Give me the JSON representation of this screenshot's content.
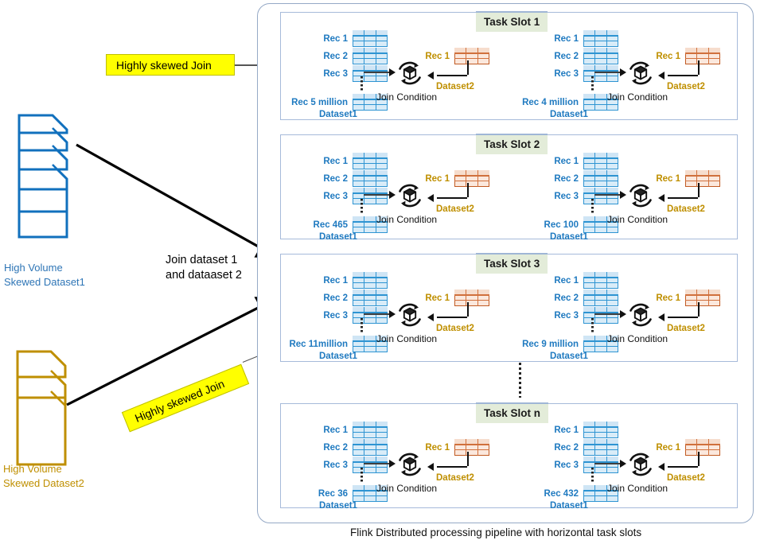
{
  "diagram": {
    "bottom_caption": "Flink Distributed processing pipeline with horizontal task slots",
    "center_note_line1": "Join dataset 1",
    "center_note_line2": "and dataaset 2"
  },
  "sources": [
    {
      "id": "dataset1",
      "caption_line1": "High Volume",
      "caption_line2": "Skewed Dataset1",
      "color": "#1170bd",
      "text_color": "#2e75b6"
    },
    {
      "id": "dataset2",
      "caption_line1": "High Volume",
      "caption_line2": "Skewed Dataset2",
      "color": "#bf8f00",
      "text_color": "#bf8f00"
    }
  ],
  "labels": {
    "skew_1": "Highly skewed Join",
    "skew_2": "Highly skewed Join"
  },
  "common": {
    "rec_1": "Rec 1",
    "rec_2": "Rec 2",
    "rec_3": "Rec 3",
    "dataset1_caption": "Dataset1",
    "dataset2_caption": "Dataset2",
    "dataset2_rec": "Rec 1",
    "join_condition": "Join Condition"
  },
  "colors": {
    "dataset1_blue": "#1f7ac0",
    "dataset2_orange": "#bf8f00",
    "slot_border": "#a6bada",
    "badge_bg": "#e3ecd9",
    "highlight_yellow": "#ffff00"
  },
  "slots": [
    {
      "badge": "Task Slot 1",
      "left": {
        "rec_1": "Rec 1",
        "rec_2": "Rec 2",
        "rec_3": "Rec 3",
        "rec_last": "Rec 5 million",
        "dataset1": "Dataset1",
        "dataset2": "Dataset2",
        "dataset2_rec": "Rec 1",
        "join_condition": "Join Condition"
      },
      "right": {
        "rec_1": "Rec 1",
        "rec_2": "Rec 2",
        "rec_3": "Rec 3",
        "rec_last": "Rec 4 million",
        "dataset1": "Dataset1",
        "dataset2": "Dataset2",
        "dataset2_rec": "Rec 1",
        "join_condition": "Join Condition"
      }
    },
    {
      "badge": "Task Slot 2",
      "left": {
        "rec_1": "Rec 1",
        "rec_2": "Rec 2",
        "rec_3": "Rec 3",
        "rec_last": "Rec 465",
        "dataset1": "Dataset1",
        "dataset2": "Dataset2",
        "dataset2_rec": "Rec 1",
        "join_condition": "Join Condition"
      },
      "right": {
        "rec_1": "Rec 1",
        "rec_2": "Rec 2",
        "rec_3": "Rec 3",
        "rec_last": "Rec 100",
        "dataset1": "Dataset1",
        "dataset2": "Dataset2",
        "dataset2_rec": "Rec 1",
        "join_condition": "Join Condition"
      }
    },
    {
      "badge": "Task Slot 3",
      "left": {
        "rec_1": "Rec 1",
        "rec_2": "Rec 2",
        "rec_3": "Rec 3",
        "rec_last": "Rec 11million",
        "dataset1": "Dataset1",
        "dataset2": "Dataset2",
        "dataset2_rec": "Rec 1",
        "join_condition": "Join Condition"
      },
      "right": {
        "rec_1": "Rec 1",
        "rec_2": "Rec 2",
        "rec_3": "Rec 3",
        "rec_last": "Rec 9 million",
        "dataset1": "Dataset1",
        "dataset2": "Dataset2",
        "dataset2_rec": "Rec 1",
        "join_condition": "Join Condition"
      }
    },
    {
      "badge": "Task Slot n",
      "left": {
        "rec_1": "Rec 1",
        "rec_2": "Rec 2",
        "rec_3": "Rec 3",
        "rec_last": "Rec 36",
        "dataset1": "Dataset1",
        "dataset2": "Dataset2",
        "dataset2_rec": "Rec 1",
        "join_condition": "Join Condition"
      },
      "right": {
        "rec_1": "Rec 1",
        "rec_2": "Rec 2",
        "rec_3": "Rec 3",
        "rec_last": "Rec 432",
        "dataset1": "Dataset1",
        "dataset2": "Dataset2",
        "dataset2_rec": "Rec 1",
        "join_condition": "Join Condition"
      }
    }
  ]
}
